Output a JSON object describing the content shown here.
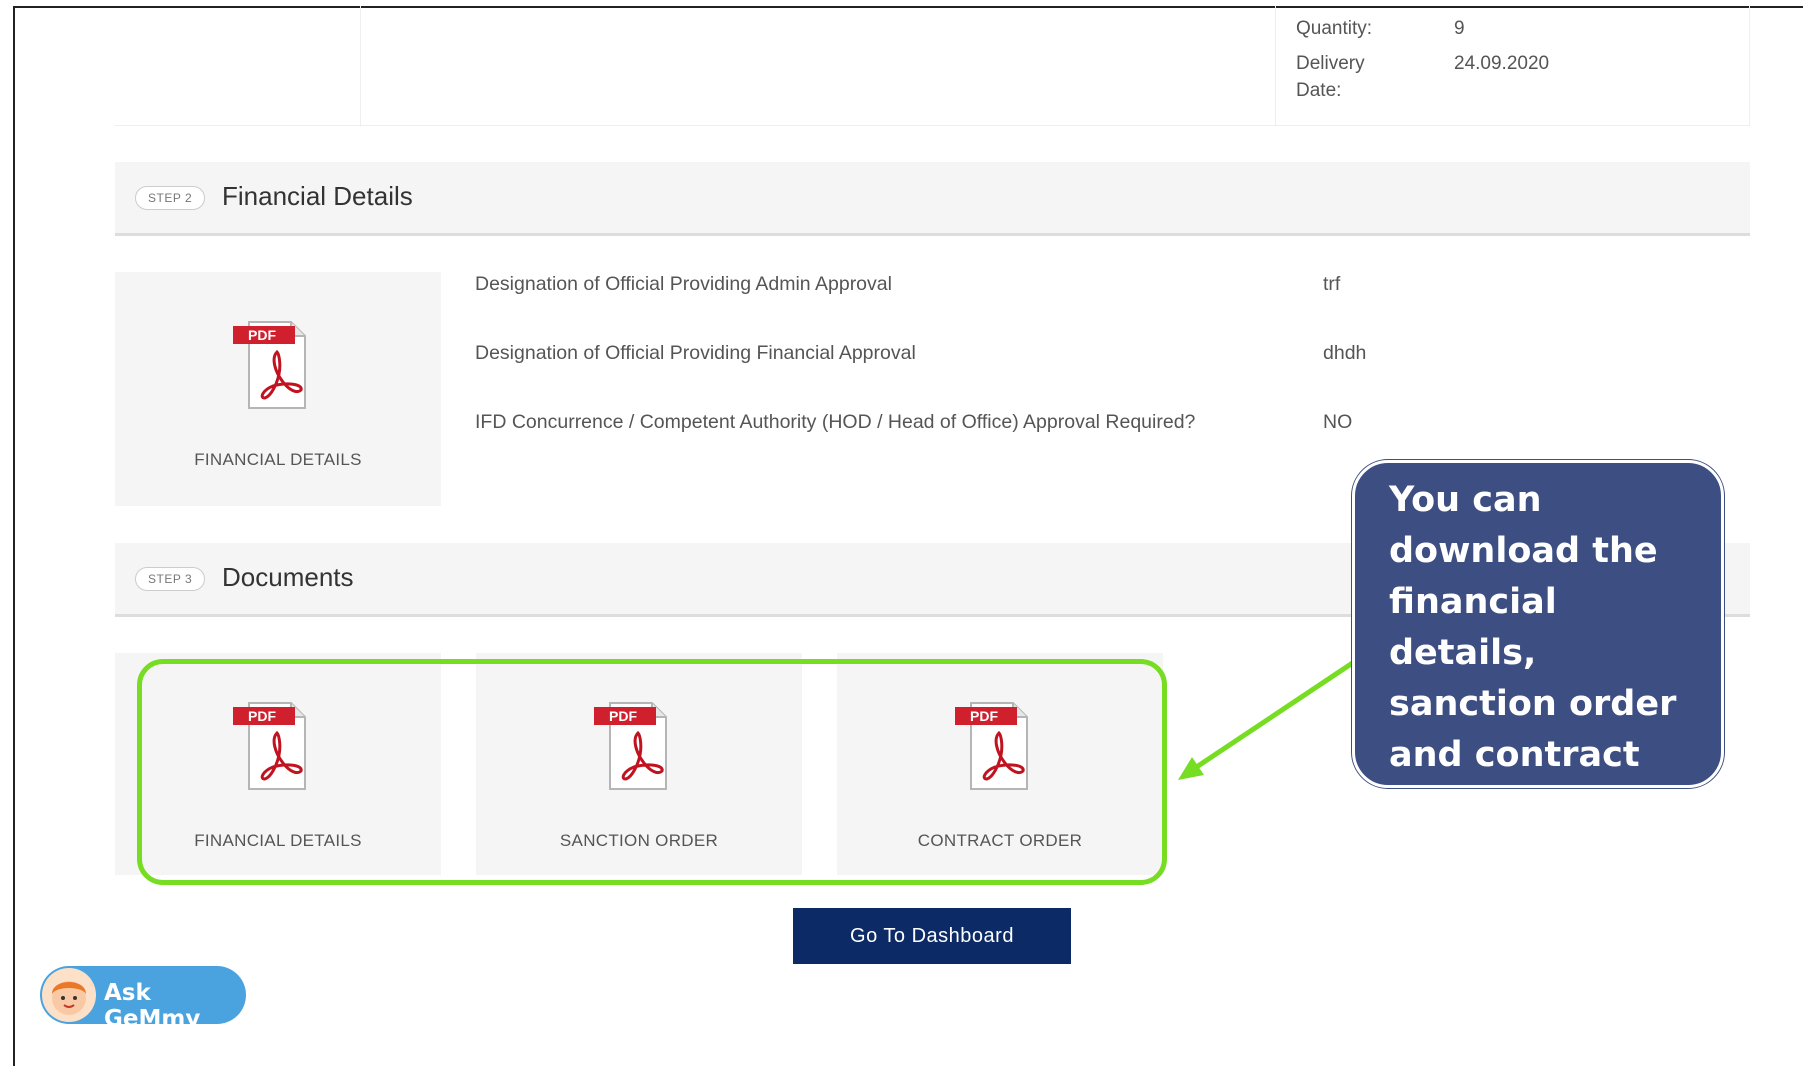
{
  "order_info": {
    "quantity_label": "Quantity:",
    "quantity_value": "9",
    "delivery_label_line1": "Delivery",
    "delivery_label_line2": "Date:",
    "delivery_value": "24.09.2020"
  },
  "step2": {
    "pill": "STEP 2",
    "title": "Financial Details",
    "tile_label": "FINANCIAL DETAILS",
    "rows": [
      {
        "label": "Designation of Official Providing Admin Approval",
        "value": "trf"
      },
      {
        "label": "Designation of Official Providing Financial Approval",
        "value": "dhdh"
      },
      {
        "label": "IFD Concurrence / Competent Authority (HOD / Head of Office) Approval Required?",
        "value": "NO"
      }
    ]
  },
  "step3": {
    "pill": "STEP 3",
    "title": "Documents",
    "documents": [
      {
        "label": "FINANCIAL DETAILS"
      },
      {
        "label": "SANCTION ORDER"
      },
      {
        "label": "CONTRACT ORDER"
      }
    ]
  },
  "pdf_badge": "PDF",
  "callout_text": "You can download the financial details, sanction order and contract order from here.",
  "dashboard_button": "Go To Dashboard",
  "assistant_button": "Ask GeMmy",
  "colors": {
    "highlight": "#76dd22",
    "callout_bg": "#3d4e82",
    "dashboard_bg": "#0c2a66",
    "assistant_bg": "#4aa3df",
    "pdf_red": "#d0202e"
  }
}
